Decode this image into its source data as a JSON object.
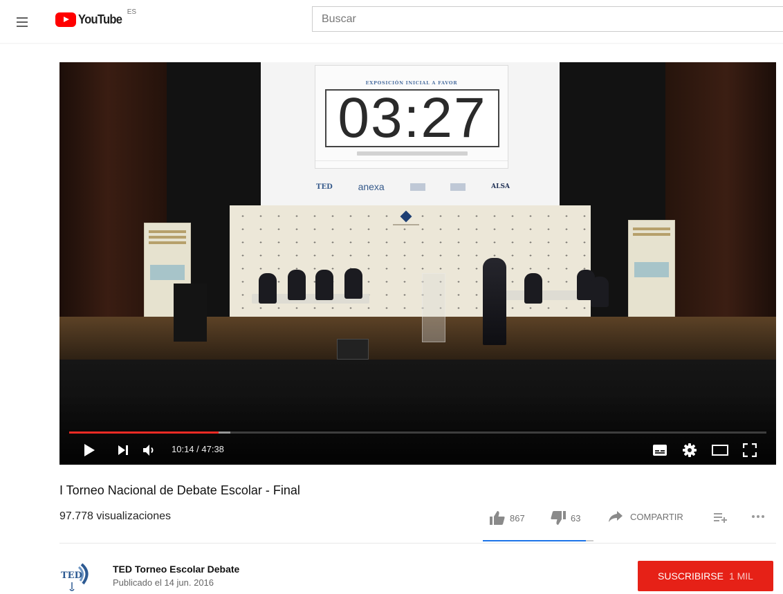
{
  "header": {
    "logo_text": "YouTube",
    "country_code": "ES",
    "search_placeholder": "Buscar"
  },
  "player": {
    "slide": {
      "heading": "EXPOSICIÓN INICIAL A FAVOR",
      "timer": "03:27",
      "sponsor_1": "TED",
      "sponsor_2": "anexa",
      "sponsor_3": "ALSA"
    },
    "time_display": "10:14 / 47:38",
    "progress_fraction": 0.214,
    "buffered_fraction": 0.231,
    "icons": {
      "play": "play-icon",
      "next": "next-icon",
      "volume": "volume-icon",
      "subtitles": "subtitles-icon",
      "settings": "gear-icon",
      "theater": "theater-mode-icon",
      "fullscreen": "fullscreen-icon"
    }
  },
  "video": {
    "title": "I Torneo Nacional de Debate Escolar - Final",
    "views": "97.778 visualizaciones",
    "likes": "867",
    "dislikes": "63",
    "share_label": "COMPARTIR",
    "like_fraction": 0.932
  },
  "channel": {
    "name": "TED Torneo Escolar Debate",
    "published": "Publicado el 14 jun. 2016",
    "logo_text": "TED",
    "subscribe_label": "SUSCRIBIRSE",
    "subscriber_count": "1 MIL"
  },
  "colors": {
    "brand_red": "#ff0000",
    "subscribe_red": "#e62117",
    "progress_red": "#f12b24",
    "like_blue": "#1b73e8"
  }
}
